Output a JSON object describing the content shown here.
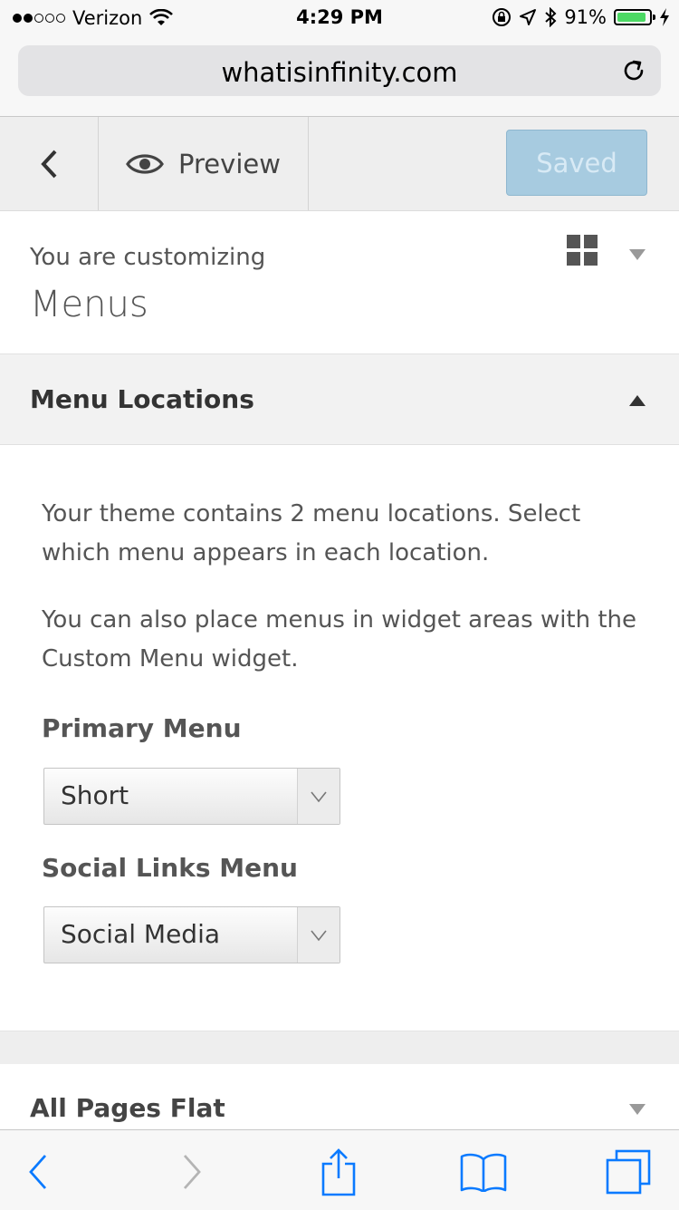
{
  "status_bar": {
    "carrier": "Verizon",
    "time": "4:29 PM",
    "battery_percent": "91%",
    "battery_level": 0.91,
    "signal_bars": 2,
    "icons": [
      "wifi-icon",
      "rotation-lock-icon",
      "location-icon",
      "bluetooth-icon",
      "battery-icon",
      "charging-icon"
    ]
  },
  "browser": {
    "url": "whatisinfinity.com"
  },
  "customizer": {
    "preview_label": "Preview",
    "saved_label": "Saved",
    "customizing_prefix": "You are customizing",
    "customizing_title": "Menus"
  },
  "section": {
    "title": "Menu Locations",
    "description_1": "Your theme contains 2 menu locations. Select which menu appears in each location.",
    "description_2": "You can also place menus in widget areas with the Custom Menu widget.",
    "fields": [
      {
        "label": "Primary Menu",
        "value": "Short"
      },
      {
        "label": "Social Links Menu",
        "value": "Social Media"
      }
    ]
  },
  "next_section": {
    "title": "All Pages Flat"
  },
  "colors": {
    "saved_button_bg": "#a7cbe0",
    "battery_fill": "#4cd964",
    "ios_blue": "#0a7aff"
  }
}
